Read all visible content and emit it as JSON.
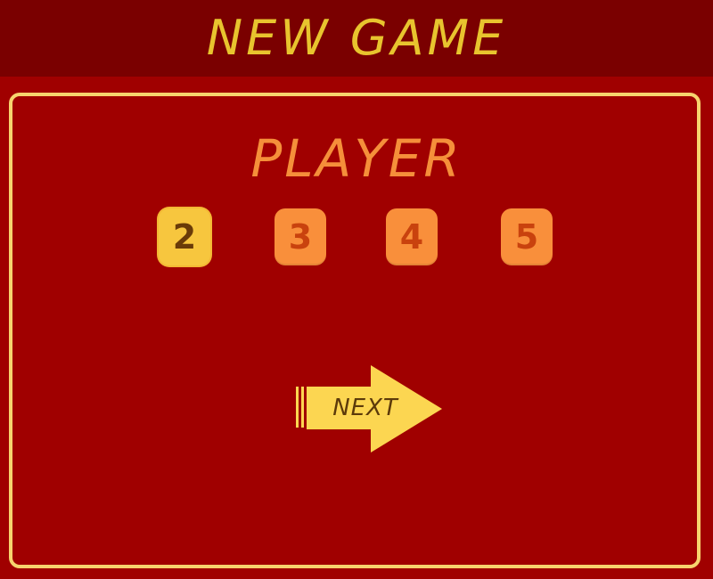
{
  "header": {
    "title": "NEW GAME"
  },
  "player_select": {
    "label": "PLAYER",
    "options": [
      "2",
      "3",
      "4",
      "5"
    ],
    "selected": "2"
  },
  "next_button": {
    "label": "NEXT"
  },
  "colors": {
    "background": "#a00000",
    "header_bar": "#7a0000",
    "title": "#e8c42e",
    "panel_border": "#f7d36e",
    "label": "#f58f3a",
    "option": "#f98f3b",
    "option_selected": "#f7c63e",
    "next_arrow": "#fcd651"
  }
}
